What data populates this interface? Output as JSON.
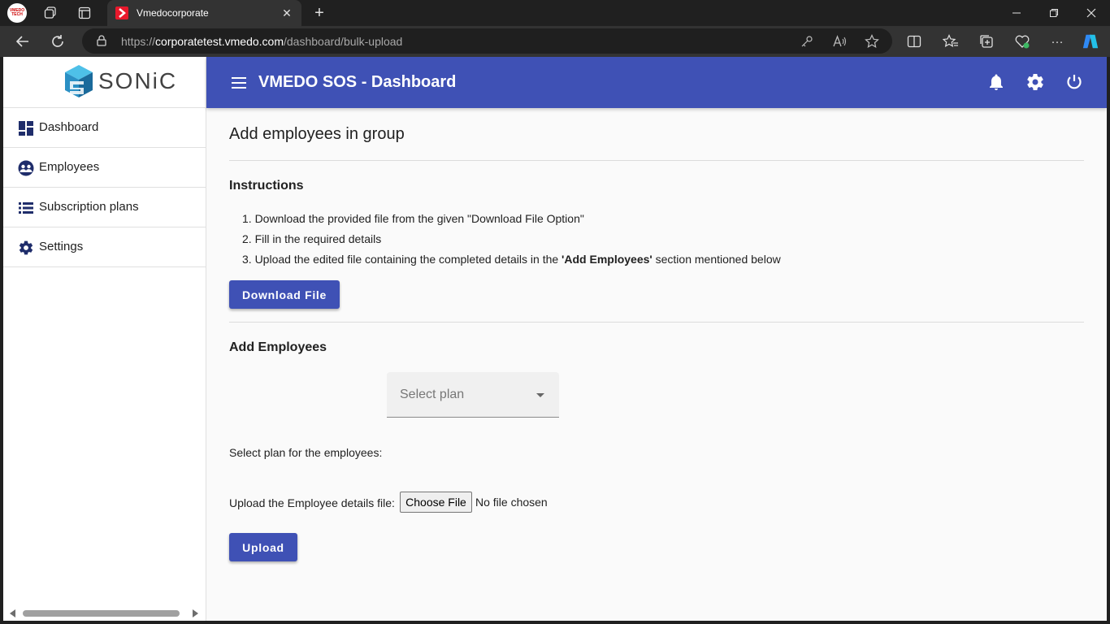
{
  "browser": {
    "profile_label": "VMEDO TECH",
    "tab_title": "Vmedocorporate",
    "url_prefix": "https://",
    "url_host": "corporatetest.vmedo.com",
    "url_path": "/dashboard/bulk-upload"
  },
  "sidebar": {
    "logo_text": "SONiC",
    "items": [
      {
        "label": "Dashboard",
        "icon": "dashboard-icon"
      },
      {
        "label": "Employees",
        "icon": "employees-icon"
      },
      {
        "label": "Subscription plans",
        "icon": "list-icon"
      },
      {
        "label": "Settings",
        "icon": "gear-icon"
      }
    ]
  },
  "topbar": {
    "title": "VMEDO SOS - Dashboard"
  },
  "main": {
    "heading": "Add employees in group",
    "instructions_title": "Instructions",
    "instructions": [
      "1. Download the provided file from the given \"Download File Option\"",
      "2. Fill in the required details",
      "3. Upload the edited file containing the completed details in the"
    ],
    "instruction3_bold": "'Add Employees'",
    "instruction3_tail": "section mentioned below",
    "download_button": "Download File",
    "add_title": "Add Employees",
    "plan_label": "Select plan for the employees:",
    "plan_placeholder": "Select plan",
    "upload_label": "Upload the Employee details file:",
    "choose_file": "Choose File",
    "file_status": "No file chosen",
    "upload_button": "Upload"
  },
  "colors": {
    "primary": "#3f51b5",
    "browser_dark": "#202020",
    "page_bg": "#fafafa"
  }
}
